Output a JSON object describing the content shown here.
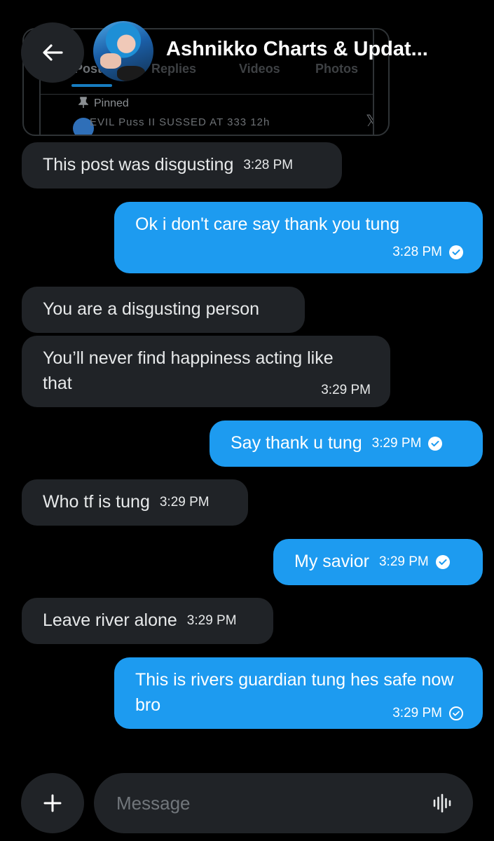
{
  "header": {
    "title": "Ashnikko Charts & Updat...",
    "back_icon": "arrow-left-icon"
  },
  "shared_card": {
    "tabs": [
      "Posts",
      "Replies",
      "Videos",
      "Photos"
    ],
    "pinned_label": "Pinned",
    "cut_text": "EVIL Puss II SUSSED AT 333  12h"
  },
  "messages": [
    {
      "direction": "in",
      "text": "This post was disgusting",
      "time": "3:28 PM"
    },
    {
      "direction": "out",
      "text": "Ok i don't care say thank you tung",
      "time": "3:28 PM",
      "status": "read"
    },
    {
      "direction": "in",
      "text": "You are a disgusting person",
      "time": ""
    },
    {
      "direction": "in",
      "text": "You’ll never find happiness acting like that",
      "time": "3:29 PM"
    },
    {
      "direction": "out",
      "text": "Say thank u tung",
      "time": "3:29 PM",
      "status": "read"
    },
    {
      "direction": "in",
      "text": "Who tf is tung",
      "time": "3:29 PM"
    },
    {
      "direction": "out",
      "text": "My savior",
      "time": "3:29 PM",
      "status": "read"
    },
    {
      "direction": "in",
      "text": "Leave river alone",
      "time": "3:29 PM"
    },
    {
      "direction": "out",
      "text": "This is rivers guardian tung hes safe now bro",
      "time": "3:29 PM",
      "status": "sent"
    }
  ],
  "composer": {
    "placeholder": "Message",
    "add_icon": "plus-icon",
    "voice_icon": "voice-waveform-icon"
  },
  "colors": {
    "background": "#000000",
    "incoming_bubble": "#202327",
    "outgoing_bubble": "#1d9bf0",
    "text": "#e7e9ea"
  }
}
